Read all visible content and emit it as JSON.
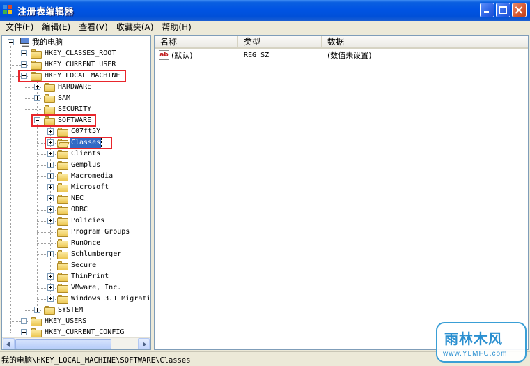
{
  "window": {
    "title": "注册表编辑器",
    "controls": {
      "minimize": "minimize",
      "maximize": "maximize",
      "close": "close"
    }
  },
  "menu": [
    "文件(F)",
    "编辑(E)",
    "查看(V)",
    "收藏夹(A)",
    "帮助(H)"
  ],
  "tree": {
    "root": "我的电脑",
    "nodes": [
      {
        "label": "HKEY_CLASSES_ROOT",
        "depth": 1,
        "expander": "plus"
      },
      {
        "label": "HKEY_CURRENT_USER",
        "depth": 1,
        "expander": "plus"
      },
      {
        "label": "HKEY_LOCAL_MACHINE",
        "depth": 1,
        "expander": "minus",
        "highlighted": true
      },
      {
        "label": "HARDWARE",
        "depth": 2,
        "expander": "plus"
      },
      {
        "label": "SAM",
        "depth": 2,
        "expander": "plus"
      },
      {
        "label": "SECURITY",
        "depth": 2,
        "expander": "none"
      },
      {
        "label": "SOFTWARE",
        "depth": 2,
        "expander": "minus",
        "highlighted": true
      },
      {
        "label": "C07ft5Y",
        "depth": 3,
        "expander": "plus"
      },
      {
        "label": "Classes",
        "depth": 3,
        "expander": "plus",
        "selected": true,
        "highlighted": true
      },
      {
        "label": "Clients",
        "depth": 3,
        "expander": "plus"
      },
      {
        "label": "Gemplus",
        "depth": 3,
        "expander": "plus"
      },
      {
        "label": "Macromedia",
        "depth": 3,
        "expander": "plus"
      },
      {
        "label": "Microsoft",
        "depth": 3,
        "expander": "plus"
      },
      {
        "label": "NEC",
        "depth": 3,
        "expander": "plus"
      },
      {
        "label": "ODBC",
        "depth": 3,
        "expander": "plus"
      },
      {
        "label": "Policies",
        "depth": 3,
        "expander": "plus"
      },
      {
        "label": "Program Groups",
        "depth": 3,
        "expander": "none"
      },
      {
        "label": "RunOnce",
        "depth": 3,
        "expander": "none"
      },
      {
        "label": "Schlumberger",
        "depth": 3,
        "expander": "plus"
      },
      {
        "label": "Secure",
        "depth": 3,
        "expander": "none"
      },
      {
        "label": "ThinPrint",
        "depth": 3,
        "expander": "plus"
      },
      {
        "label": "VMware, Inc.",
        "depth": 3,
        "expander": "plus"
      },
      {
        "label": "Windows 3.1 Migrati",
        "depth": 3,
        "expander": "plus"
      },
      {
        "label": "SYSTEM",
        "depth": 2,
        "expander": "plus"
      },
      {
        "label": "HKEY_USERS",
        "depth": 1,
        "expander": "plus"
      },
      {
        "label": "HKEY_CURRENT_CONFIG",
        "depth": 1,
        "expander": "plus"
      }
    ]
  },
  "list": {
    "columns": [
      "名称",
      "类型",
      "数据"
    ],
    "rows": [
      {
        "icon": "ab",
        "name": "(默认)",
        "type": "REG_SZ",
        "data": "(数值未设置)"
      }
    ]
  },
  "statusbar": {
    "prefix": "我的电脑",
    "path": "\\HKEY_LOCAL_MACHINE\\SOFTWARE\\Classes"
  },
  "watermark": {
    "text": "雨林木风",
    "url": "www.YLMFU.com"
  },
  "colors": {
    "highlight_box": "#e8262c",
    "selection": "#316ac5",
    "titlebar": "#0054e3"
  }
}
